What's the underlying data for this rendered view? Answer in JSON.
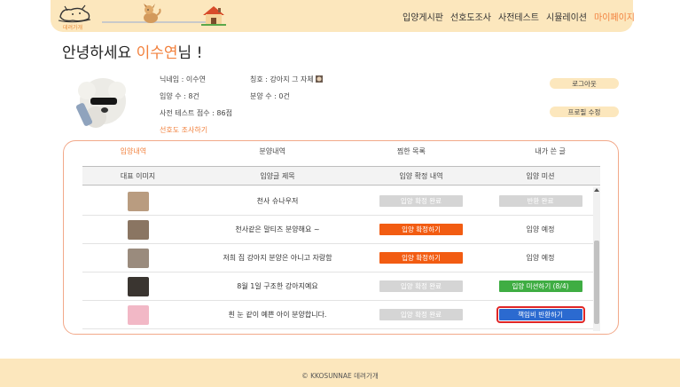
{
  "header": {
    "logo_text": "데려가개",
    "nav": [
      "입양게시판",
      "선호도조사",
      "사전테스트",
      "시뮬레이션",
      "마이페이지"
    ],
    "active_nav_index": 4
  },
  "greeting": {
    "prefix": "안녕하세요 ",
    "name": "이수연",
    "suffix": "님 !"
  },
  "profile": {
    "nickname": "닉네임 : 이수연",
    "title": "칭호 : 강아지 그 자체",
    "adopt_count": "입양 수 : 8건",
    "rehome_count": "분양 수 : 0건",
    "test_score": "사전 테스트 점수 : 86점",
    "survey_link": "선호도 조사하기",
    "logout_label": "로그아웃",
    "edit_profile_label": "프로필 수정"
  },
  "tabs": [
    "입양내역",
    "분양내역",
    "찜한 목록",
    "내가 쓴 글"
  ],
  "active_tab_index": 0,
  "table": {
    "headers": [
      "대표 이미지",
      "입양글 제목",
      "입양 확정 내역",
      "입양 미션"
    ],
    "rows": [
      {
        "title": "천사 슈나우저",
        "confirm": "입양 확정 완료",
        "confirm_style": "gray",
        "mission": "반환 완료",
        "mission_style": "gray",
        "thumb_color": "#b99c80"
      },
      {
        "title": "천사같은 말티즈 분양해요 ~",
        "confirm": "입양 확정하기",
        "confirm_style": "orange",
        "mission": "입양 예정",
        "mission_style": "plain",
        "thumb_color": "#8a7562"
      },
      {
        "title": "저희 집 강아지 분양은 아니고 자랑함",
        "confirm": "입양 확정하기",
        "confirm_style": "orange",
        "mission": "입양 예정",
        "mission_style": "plain",
        "thumb_color": "#9a8b7d"
      },
      {
        "title": "8월 1일 구조한 강아지예요",
        "confirm": "입양 확정 완료",
        "confirm_style": "gray",
        "mission": "입양 미션하기 (8/4)",
        "mission_style": "green",
        "thumb_color": "#3a3530"
      },
      {
        "title": "흰 눈 같이 예쁜 아이 분양합니다.",
        "confirm": "입양 확정 완료",
        "confirm_style": "gray",
        "mission": "책임비 반환하기",
        "mission_style": "blue",
        "thumb_color": "#f2b8c6"
      }
    ]
  },
  "footer": {
    "text": "© KKOSUNNAE 데려가개"
  }
}
